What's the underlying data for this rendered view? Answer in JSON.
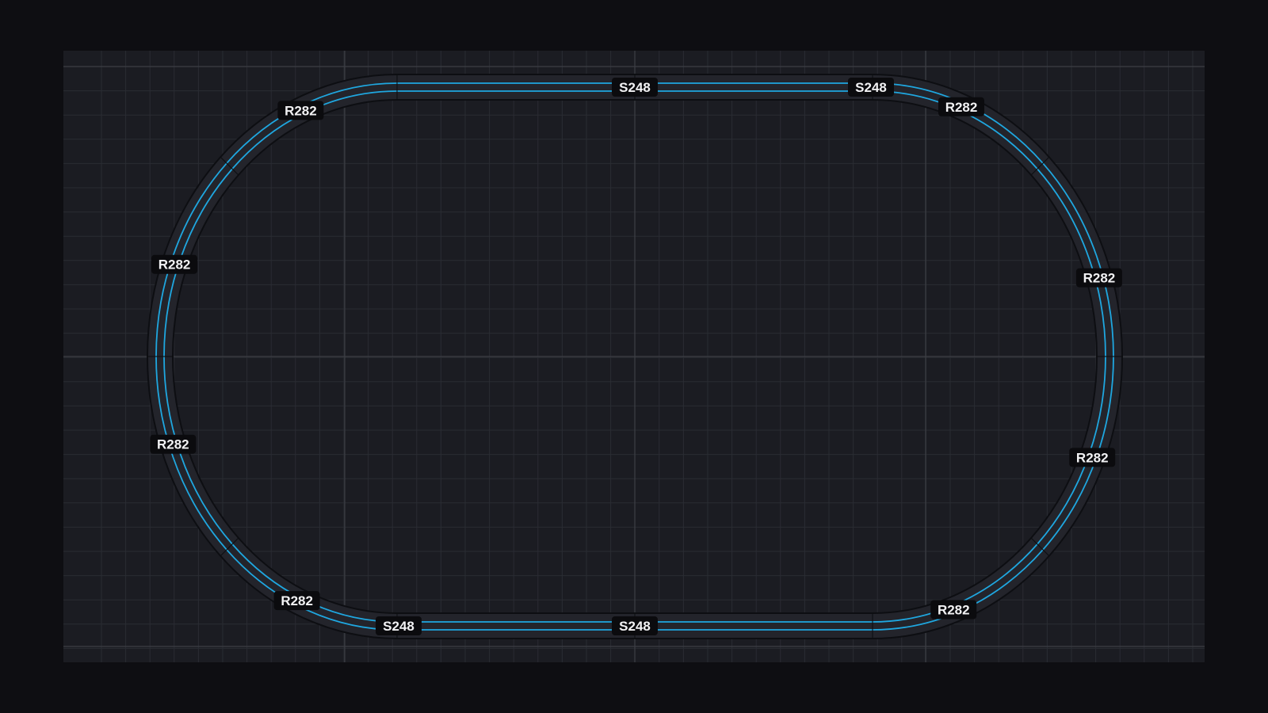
{
  "layout": {
    "title": "",
    "pieces": [
      {
        "id": "s-top-1",
        "kind": "straight",
        "label": "S248"
      },
      {
        "id": "s-top-2",
        "kind": "straight",
        "label": "S248"
      },
      {
        "id": "r-tr-1",
        "kind": "curve",
        "label": "R282"
      },
      {
        "id": "r-tr-2",
        "kind": "curve",
        "label": "R282"
      },
      {
        "id": "r-br-1",
        "kind": "curve",
        "label": "R282"
      },
      {
        "id": "r-br-2",
        "kind": "curve",
        "label": "R282"
      },
      {
        "id": "s-bot-1",
        "kind": "straight",
        "label": "S248"
      },
      {
        "id": "s-bot-2",
        "kind": "straight",
        "label": "S248"
      },
      {
        "id": "r-bl-1",
        "kind": "curve",
        "label": "R282"
      },
      {
        "id": "r-bl-2",
        "kind": "curve",
        "label": "R282"
      },
      {
        "id": "r-tl-1",
        "kind": "curve",
        "label": "R282"
      },
      {
        "id": "r-tl-2",
        "kind": "curve",
        "label": "R282"
      }
    ]
  },
  "colors": {
    "page_bg": "#0e0e12",
    "canvas_bg": "#1b1c22",
    "grid_minor": "#2a2c33",
    "grid_major": "#3c3e44",
    "track_bed": "#23242b",
    "track_edge": "#0d0e12",
    "rail": "#1fa7e0",
    "label_bg": "#0b0b0e",
    "label_text": "#f2f2f4"
  }
}
